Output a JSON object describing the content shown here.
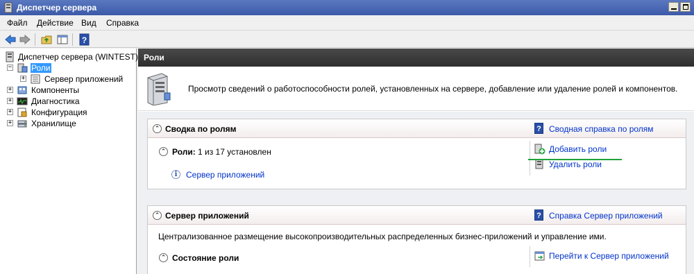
{
  "window": {
    "title": "Диспетчер сервера"
  },
  "menu": [
    "Файл",
    "Действие",
    "Вид",
    "Справка"
  ],
  "tree": {
    "root": "Диспетчер сервера (WINTEST)",
    "roles": "Роли",
    "app_server": "Сервер приложений",
    "components": "Компоненты",
    "diagnostics": "Диагностика",
    "configuration": "Конфигурация",
    "storage": "Хранилище"
  },
  "main": {
    "header": "Роли",
    "intro": "Просмотр сведений о работоспособности ролей, установленных на сервере, добавление или удаление ролей и компонентов."
  },
  "summary_panel": {
    "title": "Сводка по ролям",
    "help_link": "Сводная справка по ролям",
    "roles_label": "Роли:",
    "roles_count": "1 из 17 установлен",
    "role_link": "Сервер приложений",
    "add_roles": "Добавить роли",
    "remove_roles": "Удалить роли"
  },
  "app_panel": {
    "title": "Сервер приложений",
    "help_link": "Справка Сервер приложений",
    "description": "Централизованное размещение высокопроизводительных распределенных бизнес-приложений и управление ими.",
    "status_title": "Состояние роли",
    "goto_link": "Перейти к Сервер приложений"
  },
  "colors": {
    "link": "#0033cc",
    "accent_line": "#1fa33a",
    "selected": "#3399ff"
  }
}
